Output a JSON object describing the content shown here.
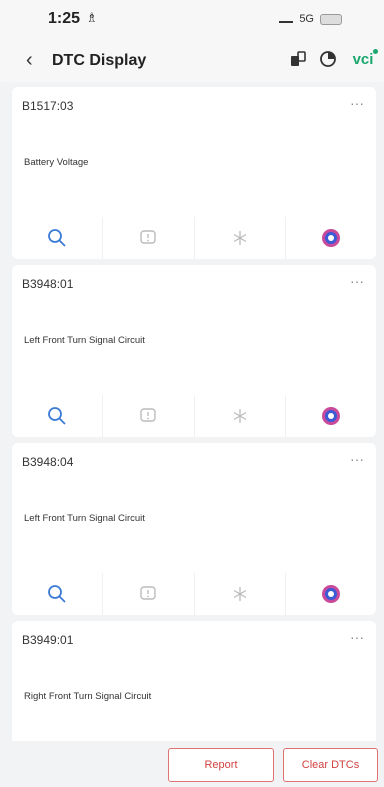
{
  "status": {
    "time": "1:25",
    "person_glyph": "♗",
    "network": "5G"
  },
  "header": {
    "back_glyph": "‹",
    "title": "DTC Display",
    "vci_label": "vci"
  },
  "dtcs": [
    {
      "code": "B1517:03",
      "description": "Battery Voltage"
    },
    {
      "code": "B3948:01",
      "description": "Left Front Turn Signal Circuit"
    },
    {
      "code": "B3948:04",
      "description": "Left Front Turn Signal Circuit"
    },
    {
      "code": "B3949:01",
      "description": "Right Front Turn Signal Circuit"
    }
  ],
  "more_glyph": "···",
  "footer": {
    "report_label": "Report",
    "clear_label": "Clear DTCs"
  },
  "colors": {
    "accent_red": "#d04040",
    "icon_blue": "#3b7bd6",
    "vci_green": "#1aa86e"
  }
}
